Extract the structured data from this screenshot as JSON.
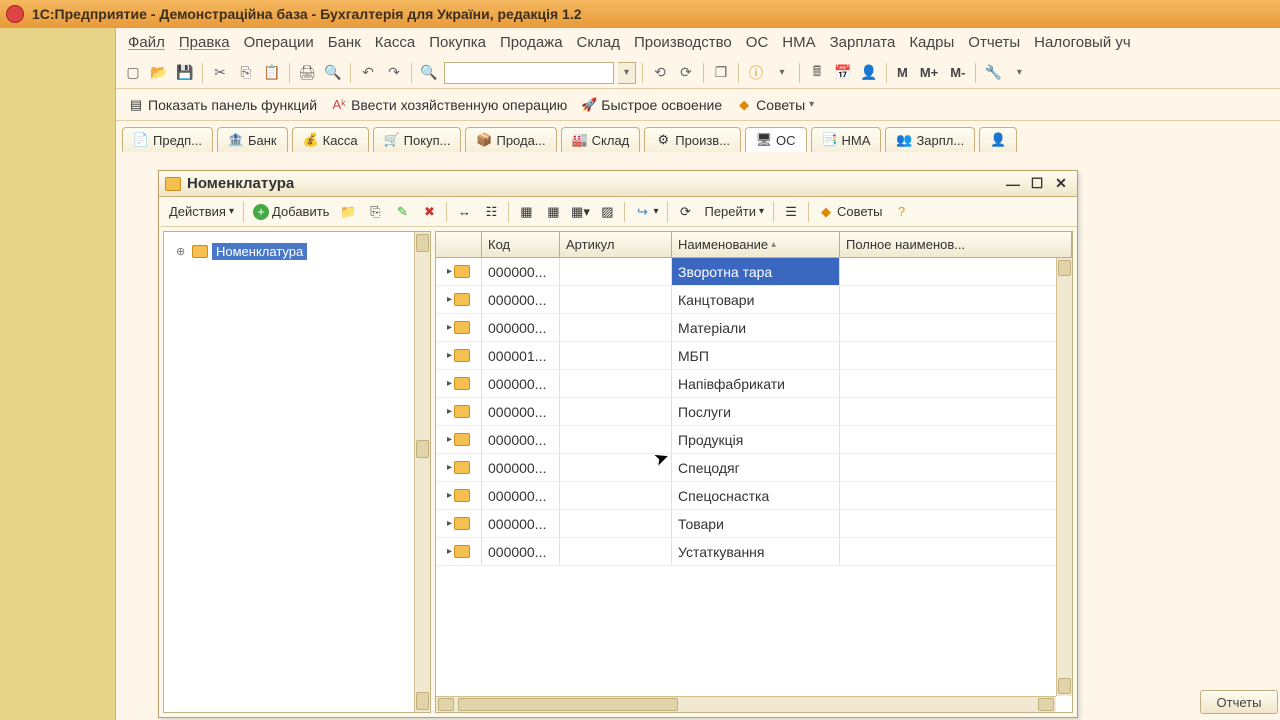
{
  "title": "1С:Предприятие - Демонстраційна база - Бухгалтерія для України, редакція 1.2",
  "menu": [
    "Файл",
    "Правка",
    "Операции",
    "Банк",
    "Касса",
    "Покупка",
    "Продажа",
    "Склад",
    "Производство",
    "ОС",
    "НМА",
    "Зарплата",
    "Кадры",
    "Отчеты",
    "Налоговый уч"
  ],
  "func_bar": {
    "show_panel": "Показать панель функций",
    "enter_op": "Ввести хозяйственную операцию",
    "quick_start": "Быстрое освоение",
    "tips": "Советы"
  },
  "tabs": [
    "Предп...",
    "Банк",
    "Касса",
    "Покуп...",
    "Прода...",
    "Склад",
    "Произв...",
    "ОС",
    "НМА",
    "Зарпл..."
  ],
  "active_tab_index": 7,
  "window": {
    "title": "Номенклатура",
    "toolbar": {
      "actions": "Действия",
      "add": "Добавить",
      "goto": "Перейти",
      "tips": "Советы"
    },
    "tree_root": "Номенклатура",
    "columns": {
      "code": "Код",
      "article": "Артикул",
      "name": "Наименование",
      "fullname": "Полное наименов..."
    },
    "rows": [
      {
        "code": "000000...",
        "article": "",
        "name": "Зворотна тара",
        "fullname": ""
      },
      {
        "code": "000000...",
        "article": "",
        "name": "Канцтовари",
        "fullname": ""
      },
      {
        "code": "000000...",
        "article": "",
        "name": "Матеріали",
        "fullname": ""
      },
      {
        "code": "000001...",
        "article": "",
        "name": "МБП",
        "fullname": ""
      },
      {
        "code": "000000...",
        "article": "",
        "name": "Напівфабрикати",
        "fullname": ""
      },
      {
        "code": "000000...",
        "article": "",
        "name": "Послуги",
        "fullname": ""
      },
      {
        "code": "000000...",
        "article": "",
        "name": "Продукція",
        "fullname": ""
      },
      {
        "code": "000000...",
        "article": "",
        "name": "Спецодяг",
        "fullname": ""
      },
      {
        "code": "000000...",
        "article": "",
        "name": "Спецоснастка",
        "fullname": ""
      },
      {
        "code": "000000...",
        "article": "",
        "name": "Товари",
        "fullname": ""
      },
      {
        "code": "000000...",
        "article": "",
        "name": "Устаткування",
        "fullname": ""
      }
    ],
    "selected_row_index": 0
  },
  "m_buttons": [
    "M",
    "M+",
    "M-"
  ],
  "reports_label": "Отчеты"
}
